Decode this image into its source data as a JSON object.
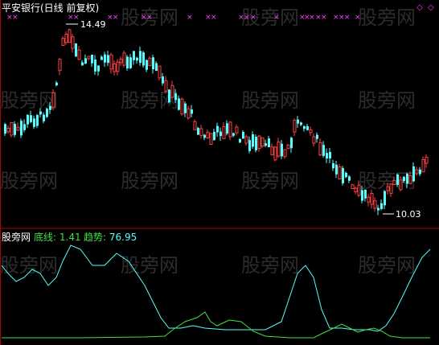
{
  "stock_title": "平安银行(日线 前复权)",
  "price_high_label": "14.49",
  "price_low_label": "10.03",
  "indicator": {
    "name": "股旁网",
    "base_label": "底线:",
    "base_value": "1.41",
    "trend_label": "趋势:",
    "trend_value": "76.95"
  },
  "watermark_text": "股旁网",
  "colors": {
    "background": "#000000",
    "candle_up": "#ff4040",
    "candle_down": "#54ffff",
    "base_line": "#40e040",
    "trend_line": "#54ffff",
    "marker": "#ff40ff",
    "divider": "#b00000",
    "label_white": "#ffffff",
    "label_green": "#40e040"
  }
}
